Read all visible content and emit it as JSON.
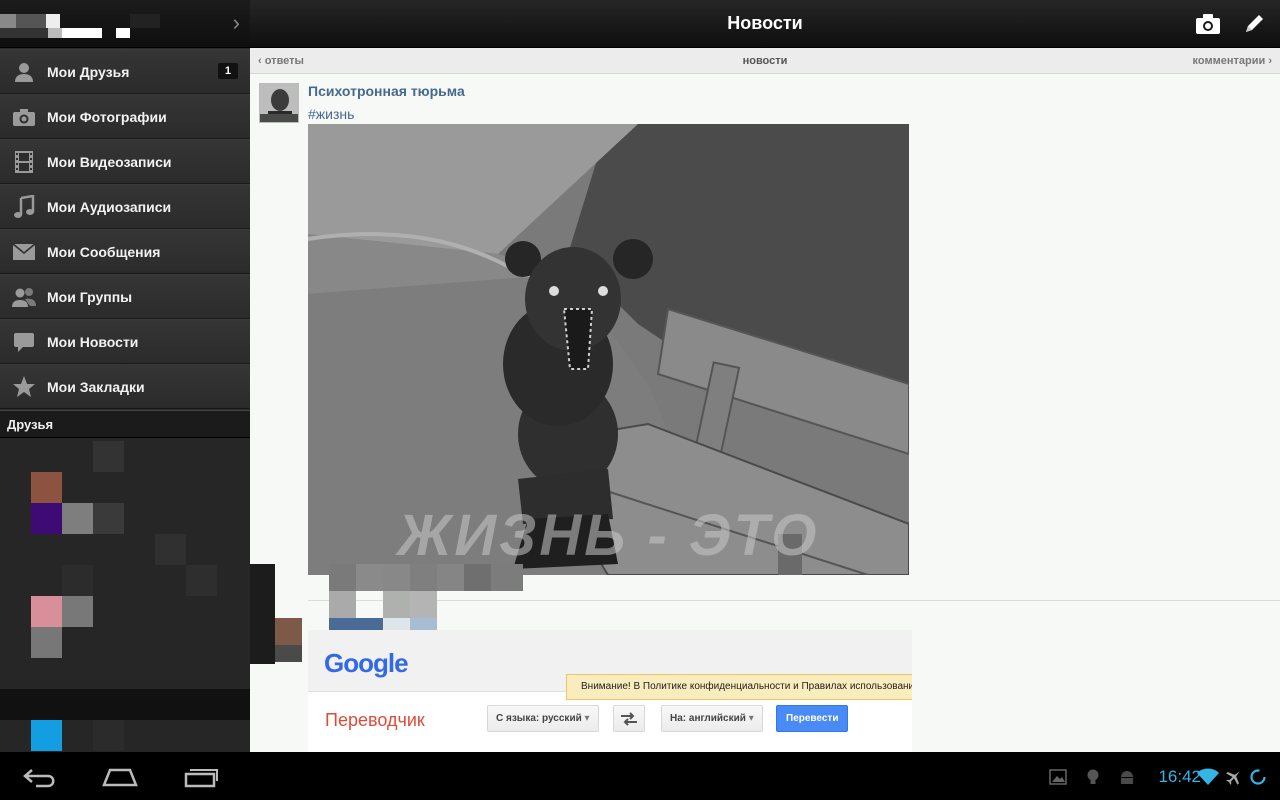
{
  "topbar": {
    "title": "Новости"
  },
  "subnav": {
    "left": "ответы",
    "center": "новости",
    "right": "комментарии"
  },
  "menu": [
    {
      "label": "Мои Друзья",
      "icon": "user-icon",
      "badge": "1"
    },
    {
      "label": "Мои Фотографии",
      "icon": "camera-icon"
    },
    {
      "label": "Мои Видеозаписи",
      "icon": "film-icon"
    },
    {
      "label": "Мои Аудиозаписи",
      "icon": "music-note-icon"
    },
    {
      "label": "Мои Сообщения",
      "icon": "envelope-icon"
    },
    {
      "label": "Мои Группы",
      "icon": "group-icon"
    },
    {
      "label": "Мои Новости",
      "icon": "speech-bubble-icon"
    },
    {
      "label": "Мои Закладки",
      "icon": "star-icon"
    }
  ],
  "friends_header": "Друзья",
  "post": {
    "author": "Психотронная тюрьма",
    "hashtag": "#жизнь",
    "photo_caption": "ЖИЗНЬ - ЭТО БОЛЬ"
  },
  "embed": {
    "logo": "Google",
    "notice": "Внимание! В Политике конфиденциальности и Правилах использования",
    "brand": "Переводчик",
    "from_lang": "С языка: русский",
    "to_lang": "На: английский",
    "translate_btn": "Перевести"
  },
  "status": {
    "time": "16:42"
  },
  "colors": {
    "accent": "#33b5e5",
    "link": "#45688e",
    "sidebar": "#2a2a2a"
  }
}
